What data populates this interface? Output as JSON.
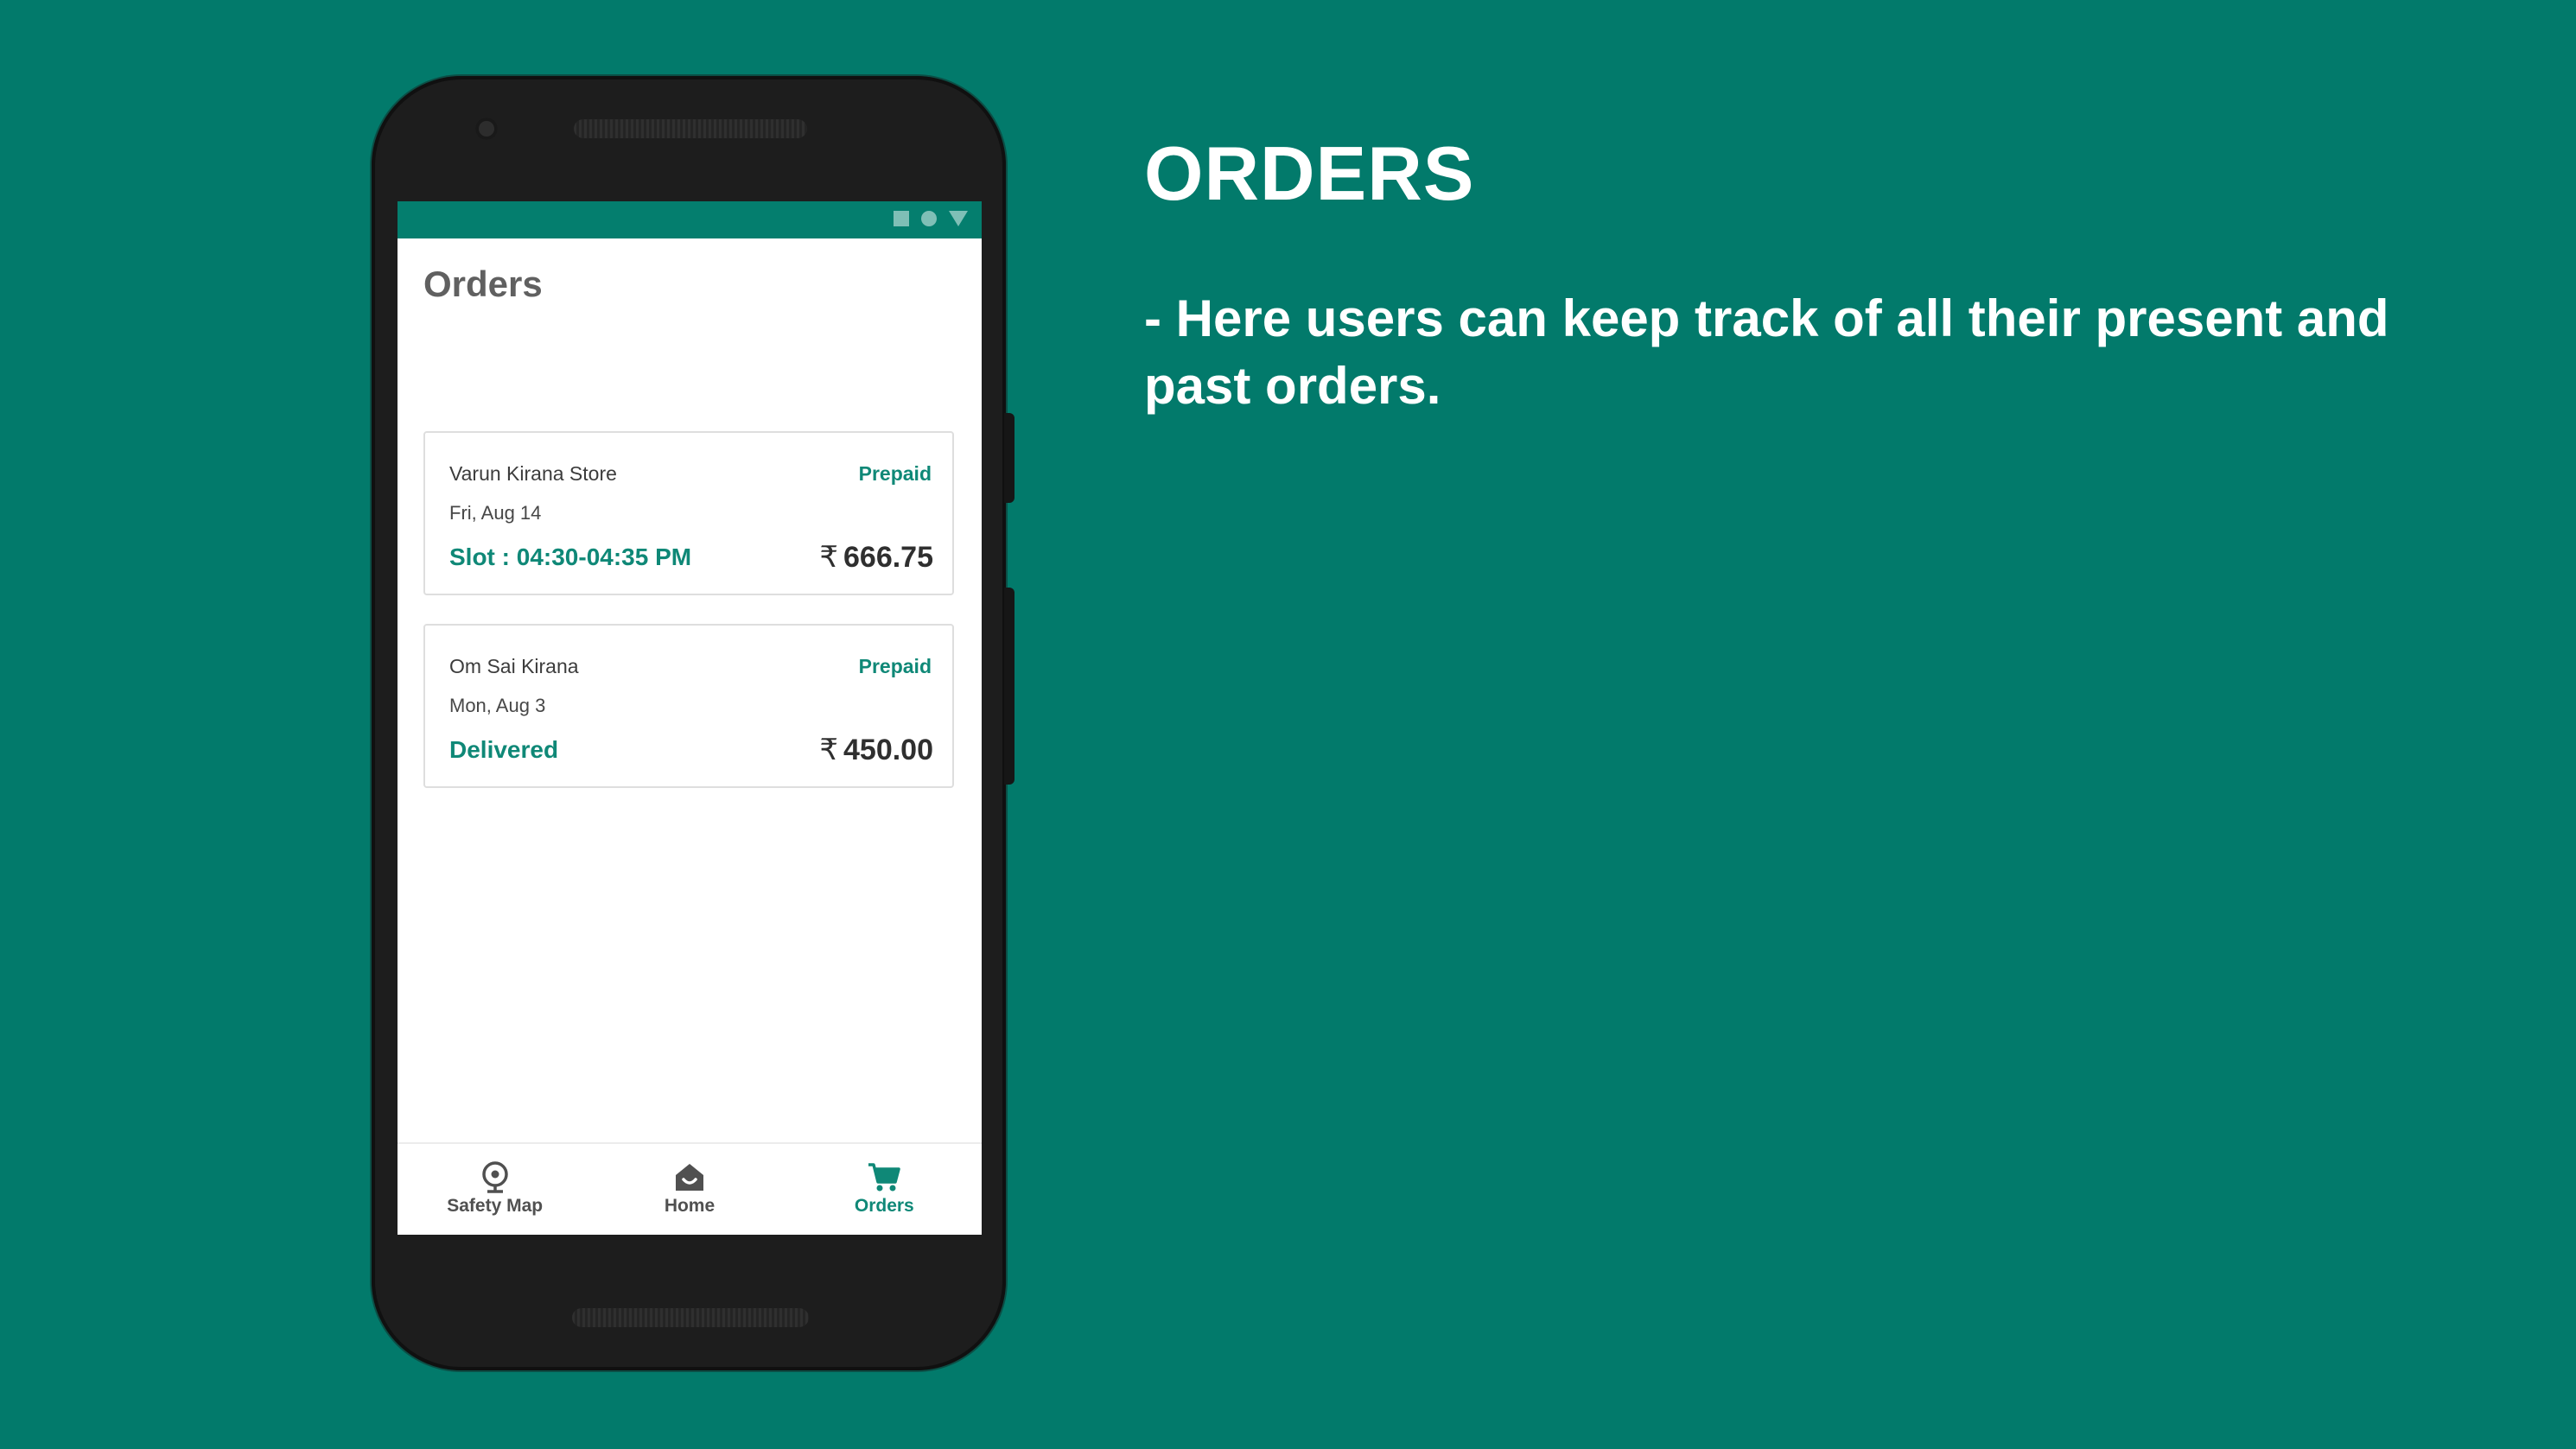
{
  "slide": {
    "heading": "ORDERS",
    "description": "- Here users can keep track of all their present and past orders."
  },
  "app": {
    "page_title": "Orders",
    "currency_symbol": "₹",
    "orders": [
      {
        "store": "Varun Kirana Store",
        "payment": "Prepaid",
        "date": "Fri, Aug 14",
        "status": "Slot : 04:30-04:35 PM",
        "amount": "666.75"
      },
      {
        "store": "Om Sai Kirana",
        "payment": "Prepaid",
        "date": "Mon, Aug 3",
        "status": "Delivered",
        "amount": "450.00"
      }
    ],
    "bottom_nav": [
      {
        "label": "Safety Map",
        "icon": "map-pin-icon",
        "active": false
      },
      {
        "label": "Home",
        "icon": "home-icon",
        "active": false
      },
      {
        "label": "Orders",
        "icon": "cart-icon",
        "active": true
      }
    ]
  },
  "colors": {
    "background": "#027a6b",
    "accent": "#0f8877",
    "status_bar": "#047e6e"
  }
}
